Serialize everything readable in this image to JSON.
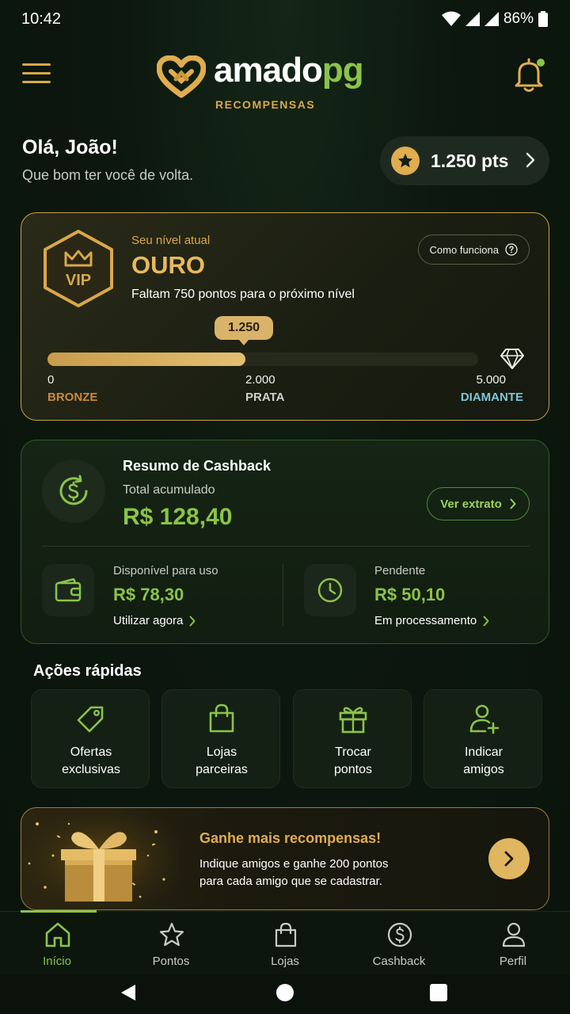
{
  "status_bar": {
    "time": "10:42",
    "battery": "86%"
  },
  "header": {
    "brand_a": "amado",
    "brand_b": "pg",
    "brand_sub": "RECOMPENSAS"
  },
  "greeting": {
    "title": "Olá, João!",
    "subtitle": "Que bom ter você de volta.",
    "points": "1.250 pts"
  },
  "level": {
    "badge": "VIP",
    "caption": "Seu nível atual",
    "name": "OURO",
    "description": "Faltam 750 pontos para o próximo nível",
    "how_it_works": "Como funciona",
    "current_points": "1.250",
    "progress_fraction": 0.46,
    "ticks": [
      {
        "value": "0",
        "name": "BRONZE",
        "color": "#c98a3e"
      },
      {
        "value": "2.000",
        "name": "PRATA",
        "color": "#d0d0cc"
      },
      {
        "value": "5.000",
        "name": "DIAMANTE",
        "color": "#7fc6d6"
      }
    ]
  },
  "cashback": {
    "title": "Resumo de Cashback",
    "total_label": "Total acumulado",
    "total_value": "R$ 128,40",
    "statement_button": "Ver extrato",
    "available": {
      "label": "Disponível para uso",
      "value": "R$ 78,30",
      "link": "Utilizar agora"
    },
    "pending": {
      "label": "Pendente",
      "value": "R$ 50,10",
      "link": "Em processamento"
    }
  },
  "quick_actions": {
    "title": "Ações rápidas",
    "items": [
      {
        "line1": "Ofertas",
        "line2": "exclusivas",
        "icon": "tag-icon"
      },
      {
        "line1": "Lojas",
        "line2": "parceiras",
        "icon": "shopping-bag-icon"
      },
      {
        "line1": "Trocar",
        "line2": "pontos",
        "icon": "gift-icon"
      },
      {
        "line1": "Indicar",
        "line2": "amigos",
        "icon": "add-user-icon"
      }
    ]
  },
  "promo": {
    "title": "Ganhe mais recompensas!",
    "line1": "Indique amigos e ganhe 200 pontos",
    "line2": "para cada amigo que se cadastrar."
  },
  "bottom_nav": {
    "items": [
      {
        "label": "Início",
        "icon": "home-icon"
      },
      {
        "label": "Pontos",
        "icon": "star-icon"
      },
      {
        "label": "Lojas",
        "icon": "shopping-bag-icon"
      },
      {
        "label": "Cashback",
        "icon": "dollar-circle-icon"
      },
      {
        "label": "Perfil",
        "icon": "user-icon"
      }
    ]
  },
  "colors": {
    "gold": "#e0ad4f",
    "green": "#8bc34a",
    "background": "#0b150d"
  }
}
